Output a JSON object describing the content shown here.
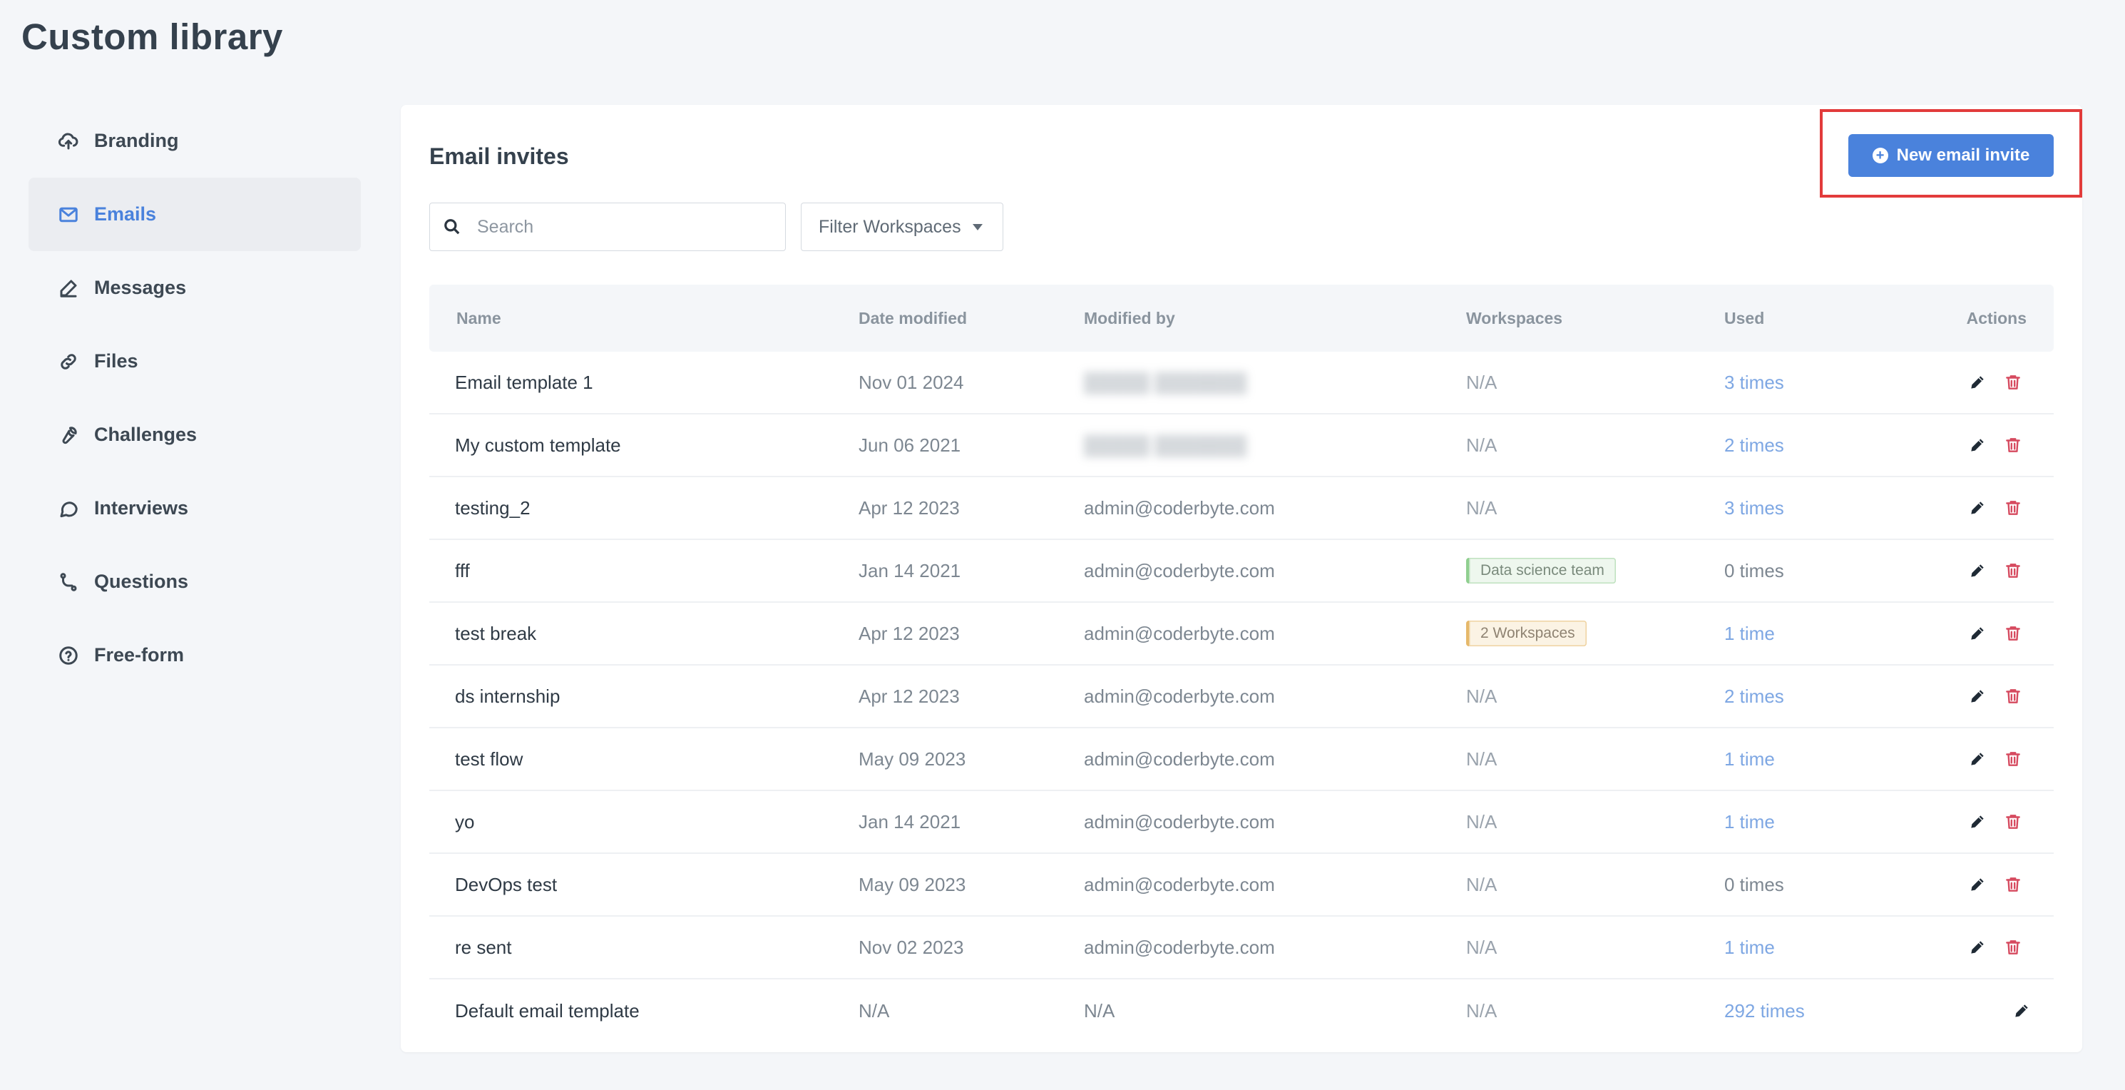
{
  "page": {
    "title": "Custom library"
  },
  "sidebar": {
    "items": [
      {
        "label": "Branding",
        "icon": "cloud-upload-icon",
        "active": false
      },
      {
        "label": "Emails",
        "icon": "mail-icon",
        "active": true
      },
      {
        "label": "Messages",
        "icon": "pencil-icon",
        "active": false
      },
      {
        "label": "Files",
        "icon": "link-icon",
        "active": false
      },
      {
        "label": "Challenges",
        "icon": "wrench-icon",
        "active": false
      },
      {
        "label": "Interviews",
        "icon": "chat-bubble-icon",
        "active": false
      },
      {
        "label": "Questions",
        "icon": "git-branch-icon",
        "active": false
      },
      {
        "label": "Free-form",
        "icon": "help-circle-icon",
        "active": false
      }
    ]
  },
  "main": {
    "title": "Email invites",
    "new_button_label": "New email invite",
    "search": {
      "placeholder": "Search",
      "value": ""
    },
    "filter_label": "Filter Workspaces",
    "columns": {
      "name": "Name",
      "date": "Date modified",
      "modified_by": "Modified by",
      "workspaces": "Workspaces",
      "used": "Used",
      "actions": "Actions"
    },
    "rows": [
      {
        "name": "Email template 1",
        "date": "Nov 01 2024",
        "modified_by": "",
        "modified_blurred": true,
        "workspaces": "N/A",
        "used": "3 times"
      },
      {
        "name": "My custom template",
        "date": "Jun 06 2021",
        "modified_by": "",
        "modified_blurred": true,
        "workspaces": "N/A",
        "used": "2 times"
      },
      {
        "name": "testing_2",
        "date": "Apr 12 2023",
        "modified_by": "admin@coderbyte.com",
        "workspaces": "N/A",
        "used": "3 times"
      },
      {
        "name": "fff",
        "date": "Jan 14 2021",
        "modified_by": "admin@coderbyte.com",
        "workspaces": "Data science team",
        "used": "0 times"
      },
      {
        "name": "test break",
        "date": "Apr 12 2023",
        "modified_by": "admin@coderbyte.com",
        "workspaces": "2 Workspaces",
        "used": "1 time"
      },
      {
        "name": "ds internship",
        "date": "Apr 12 2023",
        "modified_by": "admin@coderbyte.com",
        "workspaces": "N/A",
        "used": "2 times"
      },
      {
        "name": "test flow",
        "date": "May 09 2023",
        "modified_by": "admin@coderbyte.com",
        "workspaces": "N/A",
        "used": "1 time"
      },
      {
        "name": "yo",
        "date": "Jan 14 2021",
        "modified_by": "admin@coderbyte.com",
        "workspaces": "N/A",
        "used": "1 time"
      },
      {
        "name": "DevOps test",
        "date": "May 09 2023",
        "modified_by": "admin@coderbyte.com",
        "workspaces": "N/A",
        "used": "0 times"
      },
      {
        "name": "re sent",
        "date": "Nov 02 2023",
        "modified_by": "admin@coderbyte.com",
        "workspaces": "N/A",
        "used": "1 time"
      },
      {
        "name": "Default email template",
        "date": "N/A",
        "modified_by": "N/A",
        "workspaces": "N/A",
        "used": "292 times"
      }
    ]
  },
  "colors": {
    "accent": "#4a82dc",
    "link": "#7ea7e3",
    "delete": "#d64a5f",
    "highlight": "#e23b3b"
  }
}
